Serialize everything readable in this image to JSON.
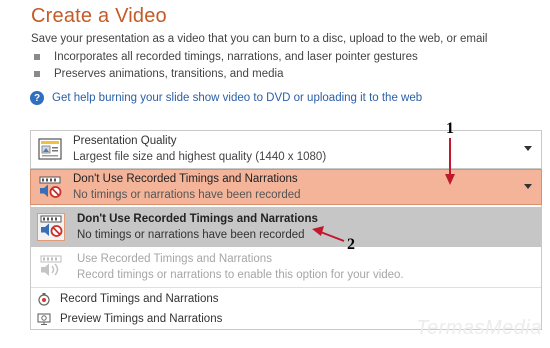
{
  "page": {
    "title": "Create a Video",
    "description": "Save your presentation as a video that you can burn to a disc, upload to the web, or email",
    "bullets": [
      "Incorporates all recorded timings, narrations, and laser pointer gestures",
      "Preserves animations, transitions, and media"
    ],
    "help_link": "Get help burning your slide show video to DVD or uploading it to the web"
  },
  "quality_dropdown": {
    "title": "Presentation Quality",
    "subtitle": "Largest file size and highest quality (1440 x 1080)"
  },
  "timings_dropdown": {
    "title": "Don't Use Recorded Timings and Narrations",
    "subtitle": "No timings or narrations have been recorded"
  },
  "menu": {
    "options": [
      {
        "title": "Don't Use Recorded Timings and Narrations",
        "subtitle": "No timings or narrations have been recorded",
        "state": "selected"
      },
      {
        "title": "Use Recorded Timings and Narrations",
        "subtitle": "Record timings or narrations to enable this option for your video.",
        "state": "disabled"
      }
    ],
    "actions": [
      {
        "label": "Record Timings and Narrations",
        "icon": "record-icon"
      },
      {
        "label": "Preview Timings and Narrations",
        "icon": "preview-icon"
      }
    ]
  },
  "annotations": {
    "marker_1": "1",
    "marker_2": "2"
  },
  "watermark": "TermasMedia",
  "colors": {
    "title": "#c55a28",
    "highlight": "#f3b49a",
    "selected_row": "#c6c6c6",
    "link": "#2a5fa8",
    "annotation_arrow": "#c0182c"
  }
}
